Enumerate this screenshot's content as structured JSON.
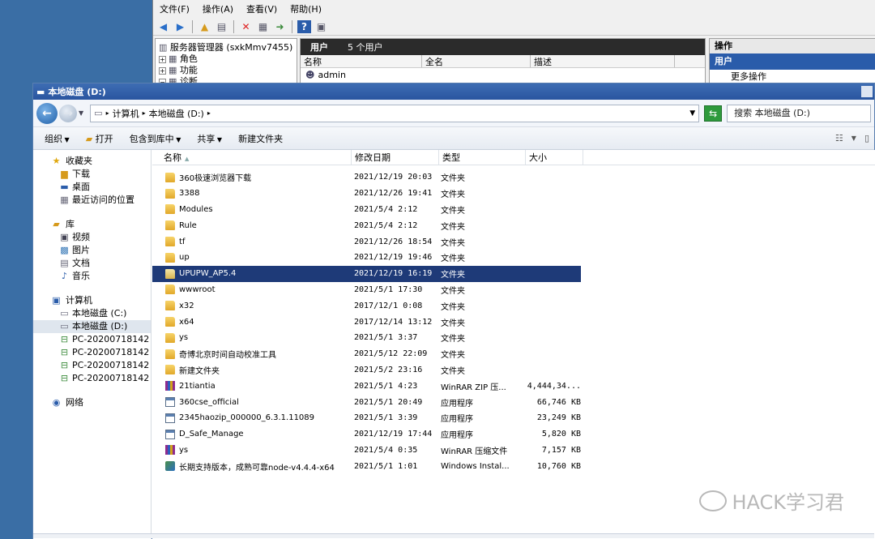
{
  "server_manager": {
    "menu": [
      "文件(F)",
      "操作(A)",
      "查看(V)",
      "帮助(H)"
    ],
    "tree": [
      {
        "label": "服务器管理器 (sxkMmv7455)",
        "expander": ""
      },
      {
        "label": "角色",
        "expander": "+"
      },
      {
        "label": "功能",
        "expander": "+"
      },
      {
        "label": "诊断",
        "expander": "−"
      }
    ],
    "users_panel": {
      "title": "用户",
      "count": "5 个用户",
      "columns": [
        "名称",
        "全名",
        "描述"
      ],
      "row": "admin"
    },
    "actions_panel": {
      "title": "操作",
      "section": "用户",
      "more": "更多操作"
    }
  },
  "explorer": {
    "title": "本地磁盘 (D:)",
    "breadcrumb": [
      "计算机",
      "本地磁盘 (D:)"
    ],
    "search_placeholder": "搜索 本地磁盘 (D:)",
    "commands": [
      "组织",
      "打开",
      "包含到库中",
      "共享",
      "新建文件夹"
    ],
    "nav": {
      "favorites": {
        "label": "收藏夹",
        "items": [
          "下载",
          "桌面",
          "最近访问的位置"
        ]
      },
      "libraries": {
        "label": "库",
        "items": [
          "视频",
          "图片",
          "文档",
          "音乐"
        ]
      },
      "computer": {
        "label": "计算机",
        "items": [
          "本地磁盘 (C:)",
          "本地磁盘 (D:)",
          "PC-20200718142 上",
          "PC-20200718142 上",
          "PC-20200718142 上",
          "PC-20200718142 上"
        ]
      },
      "network": {
        "label": "网络"
      }
    },
    "columns": {
      "name": "名称",
      "date": "修改日期",
      "type": "类型",
      "size": "大小"
    },
    "files": [
      {
        "name": "360极速浏览器下载",
        "date": "2021/12/19 20:03",
        "type": "文件夹",
        "size": "",
        "icon": "folder"
      },
      {
        "name": "3388",
        "date": "2021/12/26 19:41",
        "type": "文件夹",
        "size": "",
        "icon": "folder"
      },
      {
        "name": "Modules",
        "date": "2021/5/4 2:12",
        "type": "文件夹",
        "size": "",
        "icon": "folder"
      },
      {
        "name": "Rule",
        "date": "2021/5/4 2:12",
        "type": "文件夹",
        "size": "",
        "icon": "folder"
      },
      {
        "name": "tf",
        "date": "2021/12/26 18:54",
        "type": "文件夹",
        "size": "",
        "icon": "folder"
      },
      {
        "name": "up",
        "date": "2021/12/19 19:46",
        "type": "文件夹",
        "size": "",
        "icon": "folder"
      },
      {
        "name": "UPUPW_AP5.4",
        "date": "2021/12/19 16:19",
        "type": "文件夹",
        "size": "",
        "icon": "folder",
        "selected": true
      },
      {
        "name": "wwwroot",
        "date": "2021/5/1 17:30",
        "type": "文件夹",
        "size": "",
        "icon": "folder"
      },
      {
        "name": "x32",
        "date": "2017/12/1 0:08",
        "type": "文件夹",
        "size": "",
        "icon": "folder"
      },
      {
        "name": "x64",
        "date": "2017/12/14 13:12",
        "type": "文件夹",
        "size": "",
        "icon": "folder"
      },
      {
        "name": "ys",
        "date": "2021/5/1 3:37",
        "type": "文件夹",
        "size": "",
        "icon": "folder"
      },
      {
        "name": "奇博北京时间自动校准工具",
        "date": "2021/5/12 22:09",
        "type": "文件夹",
        "size": "",
        "icon": "folder"
      },
      {
        "name": "新建文件夹",
        "date": "2021/5/2 23:16",
        "type": "文件夹",
        "size": "",
        "icon": "folder"
      },
      {
        "name": "21tiantia",
        "date": "2021/5/1 4:23",
        "type": "WinRAR ZIP 压...",
        "size": "4,444,34...",
        "icon": "zip"
      },
      {
        "name": "360cse_official",
        "date": "2021/5/1 20:49",
        "type": "应用程序",
        "size": "66,746 KB",
        "icon": "exe"
      },
      {
        "name": "2345haozip_000000_6.3.1.11089",
        "date": "2021/5/1 3:39",
        "type": "应用程序",
        "size": "23,249 KB",
        "icon": "exe"
      },
      {
        "name": "D_Safe_Manage",
        "date": "2021/12/19 17:44",
        "type": "应用程序",
        "size": "5,820 KB",
        "icon": "exe"
      },
      {
        "name": "ys",
        "date": "2021/5/4 0:35",
        "type": "WinRAR 压缩文件",
        "size": "7,157 KB",
        "icon": "zip"
      },
      {
        "name": "长期支持版本，成熟可靠node-v4.4.4-x64",
        "date": "2021/5/1 1:01",
        "type": "Windows Instal...",
        "size": "10,760 KB",
        "icon": "msi"
      }
    ]
  },
  "watermark": "HACK学习君",
  "colors": {
    "desktop": "#3a6ea5",
    "selection": "#1e3a78",
    "titlebar": "#2a55a0"
  }
}
